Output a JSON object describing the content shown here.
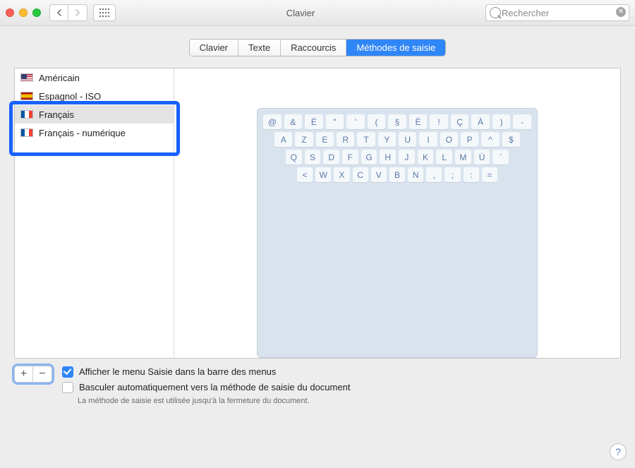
{
  "header": {
    "title": "Clavier",
    "search_placeholder": "Rechercher"
  },
  "tabs": [
    {
      "label": "Clavier",
      "active": false
    },
    {
      "label": "Texte",
      "active": false
    },
    {
      "label": "Raccourcis",
      "active": false
    },
    {
      "label": "Méthodes de saisie",
      "active": true
    }
  ],
  "sources": [
    {
      "label": "Américain",
      "flag": "us",
      "selected": false
    },
    {
      "label": "Espagnol - ISO",
      "flag": "es",
      "selected": false
    },
    {
      "label": "Français",
      "flag": "fr1",
      "selected": true
    },
    {
      "label": "Français - numérique",
      "flag": "fr2",
      "selected": false
    }
  ],
  "keyboard_rows": [
    [
      "@",
      "&",
      "É",
      "\"",
      "'",
      "(",
      "§",
      "È",
      "!",
      "Ç",
      "À",
      ")",
      "-"
    ],
    [
      "A",
      "Z",
      "E",
      "R",
      "T",
      "Y",
      "U",
      "I",
      "O",
      "P",
      "^",
      "$"
    ],
    [
      "Q",
      "S",
      "D",
      "F",
      "G",
      "H",
      "J",
      "K",
      "L",
      "M",
      "Ù",
      "`"
    ],
    [
      "<",
      "W",
      "X",
      "C",
      "V",
      "B",
      "N",
      ",",
      ";",
      ":",
      "="
    ]
  ],
  "options": {
    "show_menu": {
      "label": "Afficher le menu Saisie dans la barre des menus",
      "checked": true
    },
    "auto_switch": {
      "label": "Basculer automatiquement vers la méthode de saisie du document",
      "checked": false
    },
    "auto_switch_hint": "La méthode de saisie est utilisée jusqu'à la fermeture du document."
  },
  "buttons": {
    "add": "+",
    "remove": "−",
    "help": "?"
  }
}
